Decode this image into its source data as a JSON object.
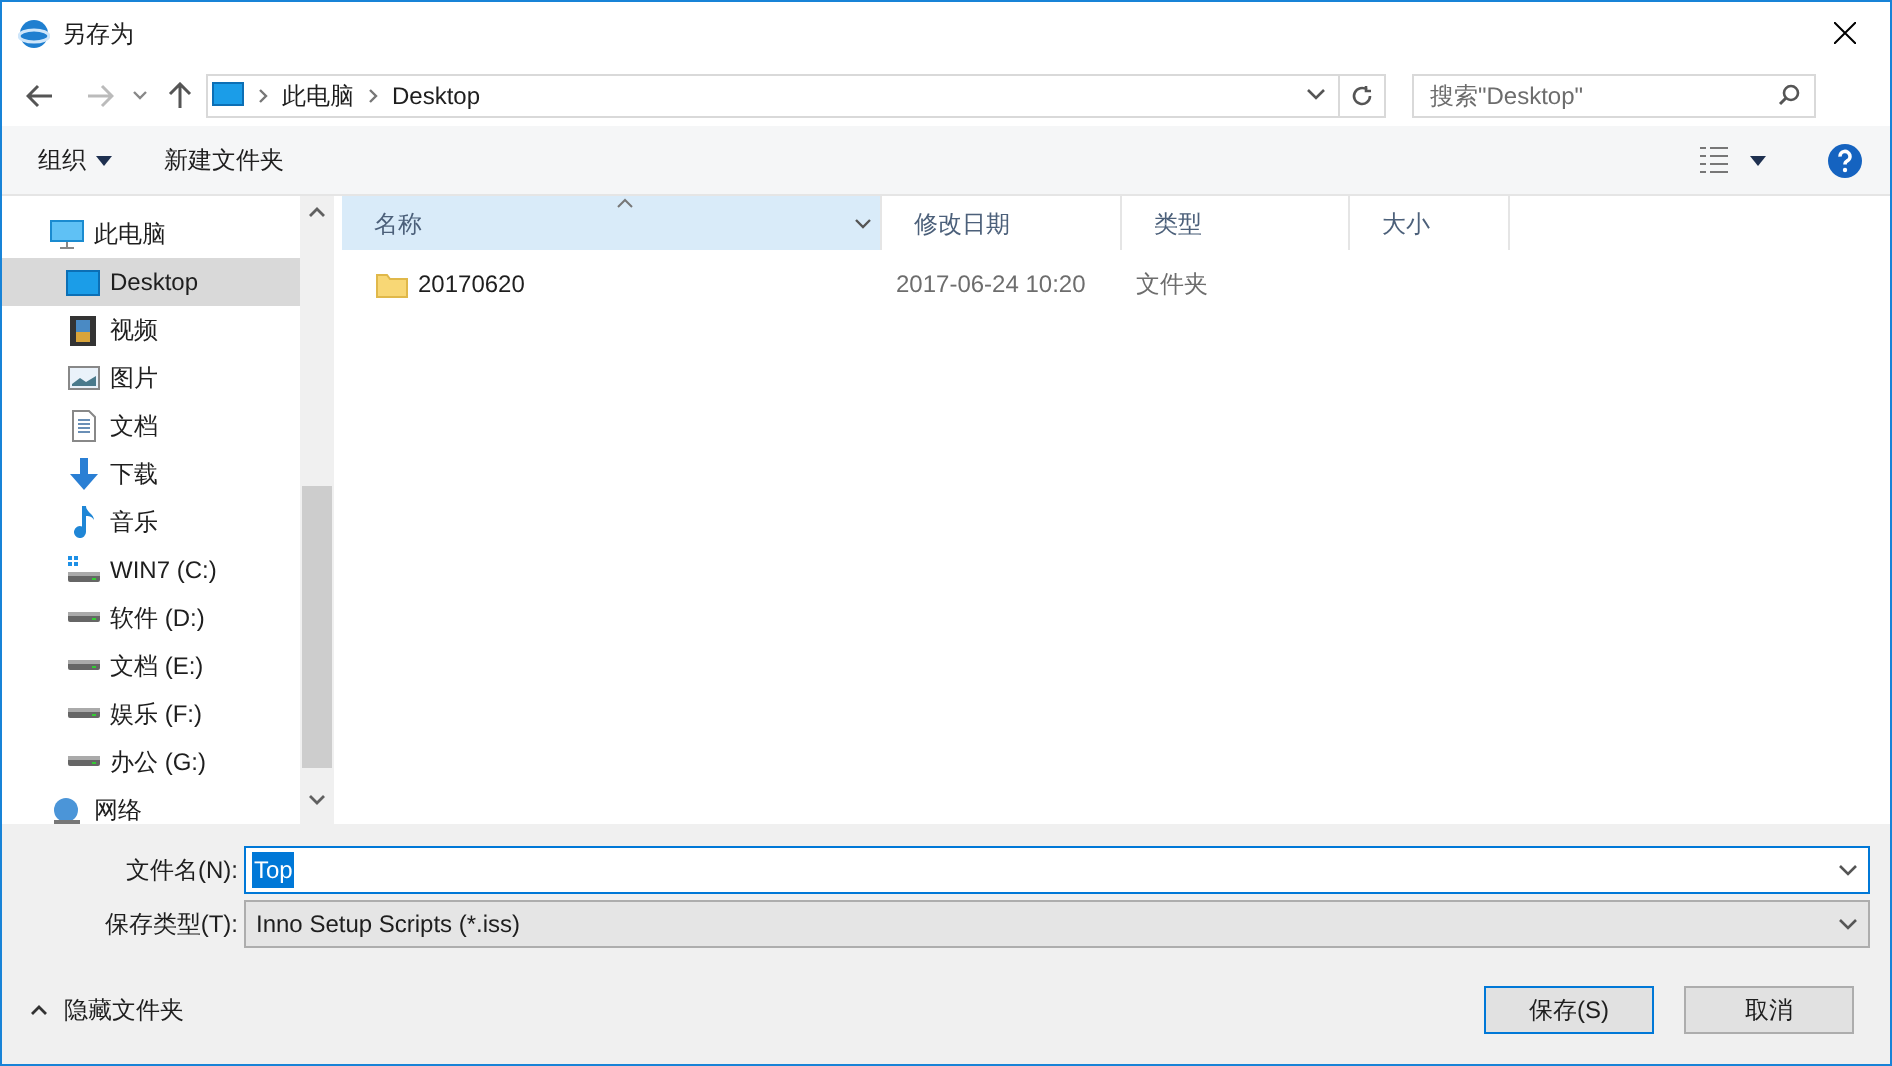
{
  "window": {
    "title": "另存为"
  },
  "breadcrumb": [
    "此电脑",
    "Desktop"
  ],
  "search": {
    "placeholder": "搜索\"Desktop\""
  },
  "toolbar": {
    "organize": "组织",
    "new_folder": "新建文件夹"
  },
  "sidebar": {
    "items": [
      {
        "label": "此电脑",
        "kind": "pc",
        "selected": false,
        "children": [
          {
            "label": "Desktop",
            "kind": "desktop",
            "selected": true
          },
          {
            "label": "视频",
            "kind": "video",
            "selected": false
          },
          {
            "label": "图片",
            "kind": "picture",
            "selected": false
          },
          {
            "label": "文档",
            "kind": "document",
            "selected": false
          },
          {
            "label": "下载",
            "kind": "download",
            "selected": false
          },
          {
            "label": "音乐",
            "kind": "music",
            "selected": false
          },
          {
            "label": "WIN7 (C:)",
            "kind": "system-drive",
            "selected": false
          },
          {
            "label": "软件 (D:)",
            "kind": "drive",
            "selected": false
          },
          {
            "label": "文档 (E:)",
            "kind": "drive",
            "selected": false
          },
          {
            "label": "娱乐 (F:)",
            "kind": "drive",
            "selected": false
          },
          {
            "label": "办公 (G:)",
            "kind": "drive",
            "selected": false
          }
        ]
      },
      {
        "label": "网络",
        "kind": "network",
        "selected": false
      }
    ]
  },
  "table": {
    "columns": [
      {
        "label": "名称",
        "sorted": true
      },
      {
        "label": "修改日期",
        "sorted": false
      },
      {
        "label": "类型",
        "sorted": false
      },
      {
        "label": "大小",
        "sorted": false
      }
    ],
    "rows": [
      {
        "name": "20170620",
        "date": "2017-06-24 10:20",
        "type": "文件夹",
        "size": ""
      }
    ]
  },
  "filename": {
    "label": "文件名(N):",
    "value": "Top"
  },
  "filetype": {
    "label": "保存类型(T):",
    "value": "Inno Setup Scripts (*.iss)"
  },
  "hide_folders": "隐藏文件夹",
  "buttons": [
    {
      "label": "保存(S)",
      "default": true
    },
    {
      "label": "取消",
      "default": false
    }
  ]
}
